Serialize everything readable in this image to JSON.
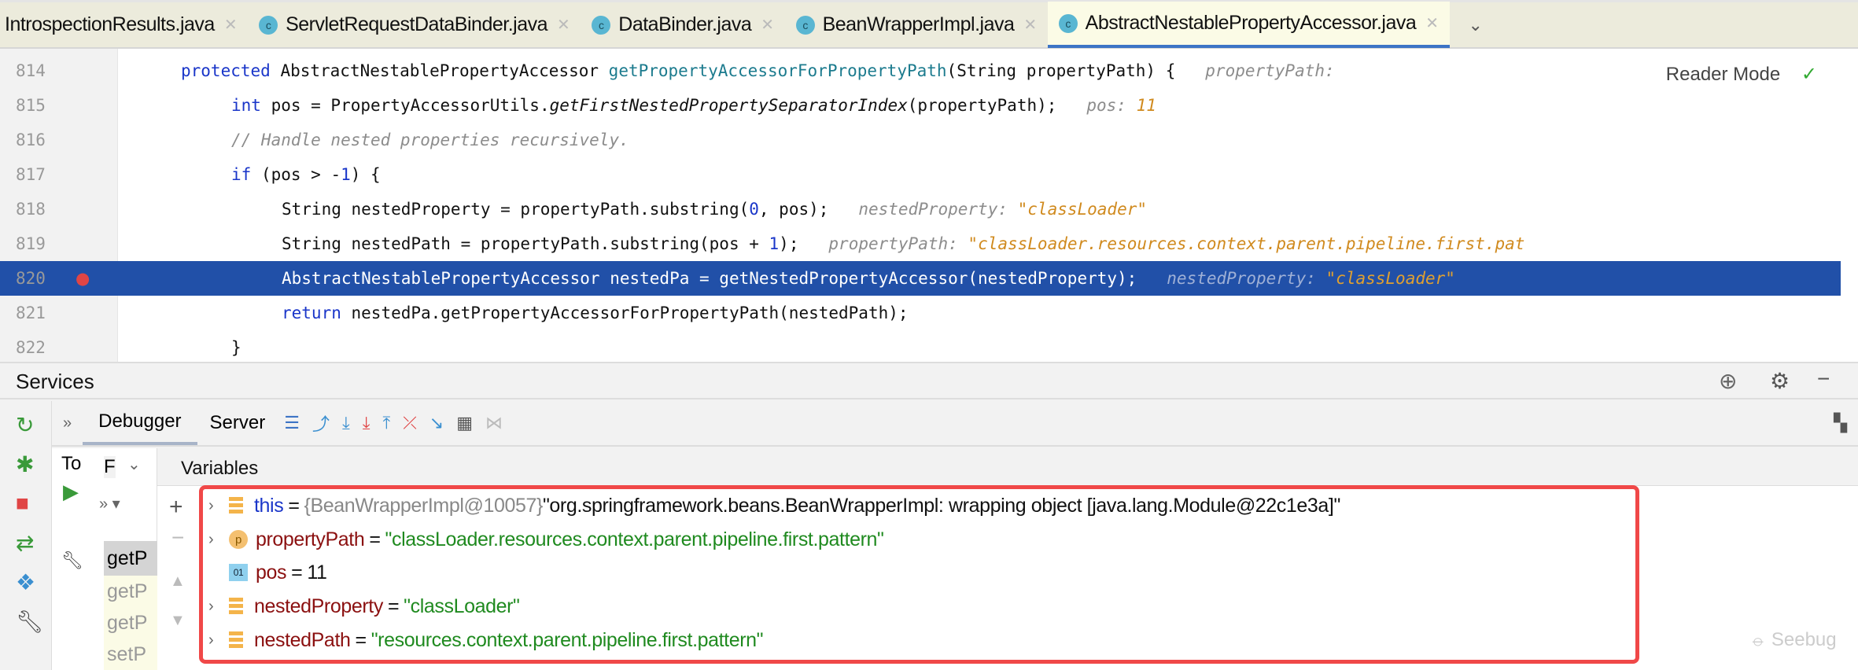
{
  "tabs": [
    {
      "label": "IntrospectionResults.java",
      "active": false
    },
    {
      "label": "ServletRequestDataBinder.java",
      "active": false
    },
    {
      "label": "DataBinder.java",
      "active": false
    },
    {
      "label": "BeanWrapperImpl.java",
      "active": false
    },
    {
      "label": "AbstractNestablePropertyAccessor.java",
      "active": true
    }
  ],
  "editor": {
    "reader_mode": "Reader Mode",
    "lines": [
      {
        "n": "814",
        "kw": "protected ",
        "t1": "AbstractNestablePropertyAccessor ",
        "fn": "getPropertyAccessorForPropertyPath",
        "t2": "(String propertyPath) {",
        "hint": "propertyPath: ",
        "hv": ""
      },
      {
        "n": "815",
        "kw": "int ",
        "t1": "pos = PropertyAccessorUtils.",
        "it": "getFirstNestedPropertySeparatorIndex",
        "t2": "(propertyPath);",
        "hint": "pos: ",
        "hv": "11"
      },
      {
        "n": "816",
        "cm": "// Handle nested properties recursively."
      },
      {
        "n": "817",
        "kw": "if ",
        "t1": "(pos > -",
        "num": "1",
        "t2": ") {"
      },
      {
        "n": "818",
        "t1": "String nestedProperty = propertyPath.substring(",
        "num": "0",
        "t2": ", pos);",
        "hint": "nestedProperty: ",
        "hv": "\"classLoader\""
      },
      {
        "n": "819",
        "t1": "String nestedPath = propertyPath.substring(pos + ",
        "num": "1",
        "t2": ");",
        "hint": "propertyPath: ",
        "hv": "\"classLoader.resources.context.parent.pipeline.first.pat"
      },
      {
        "n": "820",
        "t1": "AbstractNestablePropertyAccessor nestedPa = getNestedPropertyAccessor(nestedProperty);",
        "hint": "nestedProperty: ",
        "hv": "\"classLoader\""
      },
      {
        "n": "821",
        "kw": "return ",
        "t1": "nestedPa.getPropertyAccessorForPropertyPath(nestedPath);"
      },
      {
        "n": "822",
        "t1": "}"
      }
    ]
  },
  "services": {
    "title": "Services"
  },
  "debugger": {
    "tab_debugger": "Debugger",
    "tab_server": "Server",
    "frames_label": "F",
    "threads_label": "To",
    "variables_label": "Variables",
    "frames": [
      "getP",
      "getP",
      "getP",
      "setP"
    ]
  },
  "variables": [
    {
      "name": "this",
      "type": "{BeanWrapperImpl@10057}",
      "value": "\"org.springframework.beans.BeanWrapperImpl: wrapping object [java.lang.Module@22c1e3a]\"",
      "icon": "field-icon"
    },
    {
      "name": "propertyPath",
      "value": "\"classLoader.resources.context.parent.pipeline.first.pattern\"",
      "icon": "parameter-icon",
      "icon_text": "p"
    },
    {
      "name": "pos",
      "value": "11",
      "icon": "primitive-icon",
      "icon_text": "01"
    },
    {
      "name": "nestedProperty",
      "value": "\"classLoader\"",
      "icon": "field-icon"
    },
    {
      "name": "nestedPath",
      "value": "\"resources.context.parent.pipeline.first.pattern\"",
      "icon": "field-icon"
    }
  ],
  "watermark": "Seebug",
  "colors": {
    "highlight": "#2150a8",
    "annotation_box": "#f04848",
    "string": "#1f8a1f",
    "keyword": "#1a36c9"
  }
}
